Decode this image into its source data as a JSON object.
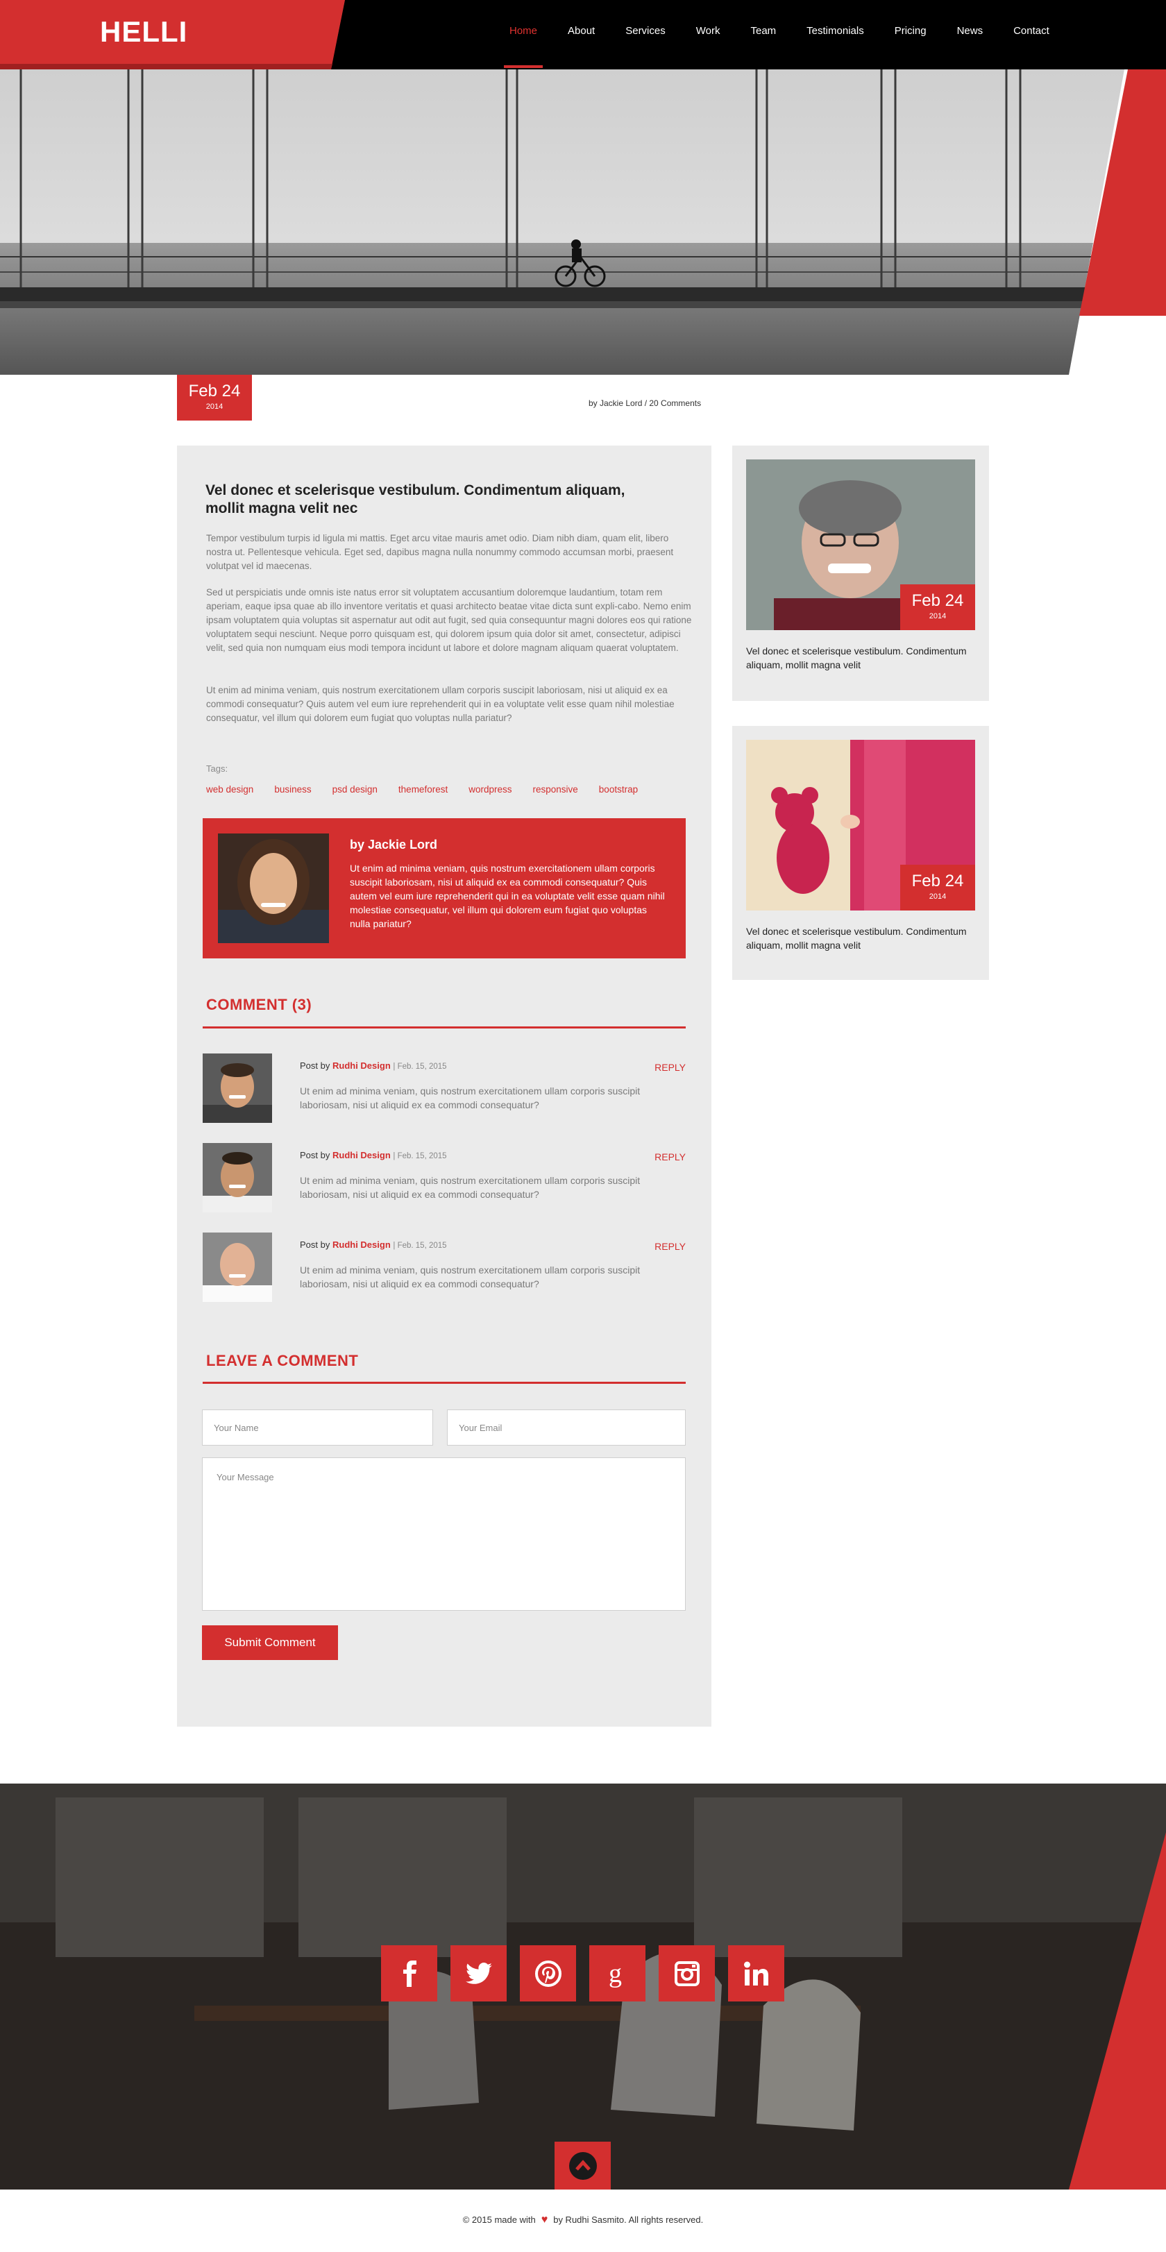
{
  "brand": {
    "logo": "HELLI",
    "accent": "#d32f2f"
  },
  "nav": [
    {
      "label": "Home",
      "active": true
    },
    {
      "label": "About"
    },
    {
      "label": "Services"
    },
    {
      "label": "Work"
    },
    {
      "label": "Team"
    },
    {
      "label": "Testimonials"
    },
    {
      "label": "Pricing"
    },
    {
      "label": "News"
    },
    {
      "label": "Contact"
    }
  ],
  "post": {
    "date_day": "Feb 24",
    "date_year": "2014",
    "meta": "by Jackie Lord / 20 Comments",
    "title": "Vel donec et scelerisque vestibulum. Condimentum aliquam, mollit magna velit nec",
    "paragraphs": [
      "Tempor vestibulum turpis id ligula mi mattis. Eget arcu vitae mauris amet odio. Diam nibh diam, quam elit, libero nostra ut. Pellentesque vehicula. Eget sed, dapibus magna nulla nonummy commodo accumsan morbi, praesent volutpat vel id maecenas.",
      "Sed ut perspiciatis unde omnis iste natus error sit voluptatem accusantium doloremque laudantium, totam rem aperiam, eaque ipsa quae ab illo inventore veritatis et quasi architecto beatae vitae dicta sunt expli-cabo. Nemo enim ipsam voluptatem quia voluptas sit aspernatur aut odit aut fugit, sed quia consequuntur magni dolores eos qui ratione voluptatem sequi nesciunt. Neque porro quisquam est, qui dolorem ipsum quia dolor sit amet, consectetur, adipisci velit, sed quia non numquam eius modi tempora incidunt ut labore et dolore magnam aliquam quaerat voluptatem.",
      "Ut enim ad minima veniam, quis nostrum exercitationem ullam corporis suscipit laboriosam, nisi ut aliquid ex ea commodi consequatur? Quis autem vel eum iure reprehenderit qui in ea voluptate velit esse quam nihil molestiae consequatur, vel illum qui dolorem eum fugiat quo voluptas nulla pariatur?"
    ],
    "tags_label": "Tags:",
    "tags": [
      "web design",
      "business",
      "psd design",
      "themeforest",
      "wordpress",
      "responsive",
      "bootstrap"
    ]
  },
  "author": {
    "name": "by Jackie Lord",
    "bio": "Ut enim ad minima veniam, quis nostrum exercitationem ullam corporis suscipit laboriosam, nisi ut aliquid ex ea commodi consequatur? Quis autem vel eum iure reprehenderit qui in ea voluptate velit esse quam nihil molestiae consequatur, vel illum qui dolorem eum fugiat quo voluptas nulla pariatur?"
  },
  "comments": {
    "heading": "COMMENT (3)",
    "items": [
      {
        "prefix": "Post by",
        "author": "Rudhi Design",
        "date": "| Feb. 15, 2015",
        "text": "Ut enim ad minima veniam, quis nostrum exercitationem ullam corporis suscipit laboriosam, nisi ut aliquid ex ea commodi consequatur?",
        "reply": "REPLY"
      },
      {
        "prefix": "Post by",
        "author": "Rudhi Design",
        "date": "| Feb. 15, 2015",
        "text": "Ut enim ad minima veniam, quis nostrum exercitationem ullam corporis suscipit laboriosam, nisi ut aliquid ex ea commodi consequatur?",
        "reply": "REPLY"
      },
      {
        "prefix": "Post by",
        "author": "Rudhi Design",
        "date": "| Feb. 15, 2015",
        "text": "Ut enim ad minima veniam, quis nostrum exercitationem ullam corporis suscipit laboriosam, nisi ut aliquid ex ea commodi consequatur?",
        "reply": "REPLY"
      }
    ]
  },
  "form": {
    "heading": "LEAVE A COMMENT",
    "name_placeholder": "Your Name",
    "email_placeholder": "Your Email",
    "message_placeholder": "Your Message",
    "submit_label": "Submit Comment"
  },
  "sidebar": [
    {
      "date_day": "Feb 24",
      "date_year": "2014",
      "text": "Vel donec et scelerisque vestibulum. Condimentum aliquam, mollit magna velit"
    },
    {
      "date_day": "Feb 24",
      "date_year": "2014",
      "text": "Vel donec et scelerisque vestibulum. Condimentum aliquam, mollit magna velit"
    }
  ],
  "footer": {
    "social": [
      "facebook-icon",
      "twitter-icon",
      "pinterest-icon",
      "google-plus-icon",
      "instagram-icon",
      "linkedin-icon"
    ],
    "copyright_left": "© 2015 made with",
    "copyright_right": "by Rudhi Sasmito. All rights reserved."
  }
}
